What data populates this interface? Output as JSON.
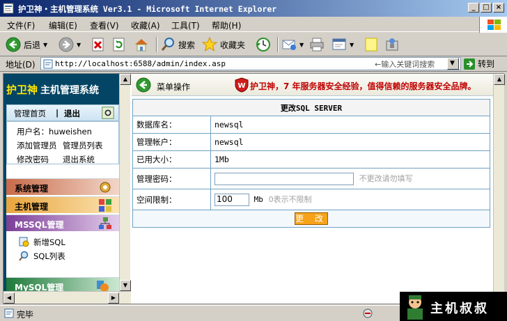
{
  "window": {
    "title": "护卫神・主机管理系统 Ver3.1 - Microsoft Internet Explorer"
  },
  "menubar": {
    "items": [
      "文件(F)",
      "编辑(E)",
      "查看(V)",
      "收藏(A)",
      "工具(T)",
      "帮助(H)"
    ]
  },
  "toolbar": {
    "back": "后退",
    "search": "搜索",
    "favorites": "收藏夹"
  },
  "address": {
    "label": "地址(D)",
    "url": "http://localhost:6588/admin/index.asp",
    "hint": "←输入关键词搜索",
    "go": "转到"
  },
  "sidebar": {
    "brand": "护卫神",
    "brand_sub": "主机管理系统",
    "home": "管理首页",
    "divider": "|",
    "logout": "退出",
    "user_label": "用户名：huweishen",
    "links": [
      "添加管理员",
      "管理员列表",
      "修改密码",
      "退出系统"
    ],
    "sections": [
      "系统管理",
      "主机管理",
      "MSSQL管理",
      "MySQL管理"
    ],
    "mssql_items": [
      "新增SQL",
      "SQL列表"
    ]
  },
  "main": {
    "menu_label": "菜单操作",
    "slogan": "护卫神，7 年服务器安全经验，值得信赖的服务器安全品牌。",
    "form": {
      "title": "更改SQL SERVER",
      "rows": [
        {
          "label": "数据库名：",
          "value": "newsql"
        },
        {
          "label": "管理帐户：",
          "value": "newsql"
        },
        {
          "label": "已用大小：",
          "value": "1Mb"
        }
      ],
      "password": {
        "label": "管理密码：",
        "value": "",
        "hint": "不更改请勿填写"
      },
      "quota": {
        "label": "空间限制：",
        "value": "100",
        "unit": "Mb",
        "hint": "0表示不限制"
      },
      "submit": "更 改"
    }
  },
  "status": {
    "text": "完毕"
  },
  "watermark": {
    "text": "主机叔叔"
  }
}
